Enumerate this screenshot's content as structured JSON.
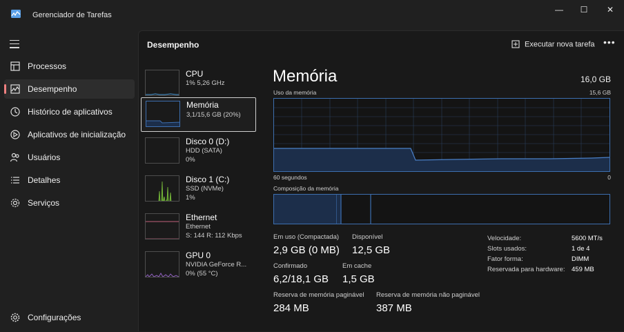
{
  "app": {
    "title": "Gerenciador de Tarefas"
  },
  "window_controls": {
    "minimize": "—",
    "maximize": "☐",
    "close": "✕"
  },
  "sidebar": {
    "items": [
      {
        "label": "Processos",
        "icon": "processes-icon"
      },
      {
        "label": "Desempenho",
        "icon": "performance-icon",
        "active": true
      },
      {
        "label": "Histórico de aplicativos",
        "icon": "history-icon"
      },
      {
        "label": "Aplicativos de inicialização",
        "icon": "startup-icon"
      },
      {
        "label": "Usuários",
        "icon": "users-icon"
      },
      {
        "label": "Detalhes",
        "icon": "details-icon"
      },
      {
        "label": "Serviços",
        "icon": "services-icon"
      }
    ],
    "settings_label": "Configurações"
  },
  "header": {
    "title": "Desempenho",
    "new_task_label": "Executar nova tarefa",
    "more": "•••"
  },
  "devices": [
    {
      "name": "CPU",
      "line1": "1% 5,26 GHz",
      "line2": ""
    },
    {
      "name": "Memória",
      "line1": "3,1/15,6 GB (20%)",
      "line2": "",
      "selected": true
    },
    {
      "name": "Disco 0 (D:)",
      "line1": "HDD (SATA)",
      "line2": "0%"
    },
    {
      "name": "Disco 1 (C:)",
      "line1": "SSD (NVMe)",
      "line2": "1%"
    },
    {
      "name": "Ethernet",
      "line1": "Ethernet",
      "line2": "S: 144 R: 112 Kbps"
    },
    {
      "name": "GPU 0",
      "line1": "NVIDIA GeForce R...",
      "line2": "0% (55 °C)"
    }
  ],
  "memory": {
    "title": "Memória",
    "total": "16,0 GB",
    "usage_label": "Uso da memória",
    "usage_max": "15,6 GB",
    "time_left": "60 segundos",
    "time_right": "0",
    "composition_label": "Composição da memória",
    "stats": {
      "in_use_label": "Em uso (Compactada)",
      "in_use_value": "2,9 GB (0 MB)",
      "available_label": "Disponível",
      "available_value": "12,5 GB",
      "committed_label": "Confirmado",
      "committed_value": "6,2/18,1 GB",
      "cached_label": "Em cache",
      "cached_value": "1,5 GB",
      "paged_label": "Reserva de memória paginável",
      "paged_value": "284 MB",
      "nonpaged_label": "Reserva de memória não paginável",
      "nonpaged_value": "387 MB"
    },
    "specs": [
      {
        "label": "Velocidade:",
        "value": "5600 MT/s"
      },
      {
        "label": "Slots usados:",
        "value": "1 de 4"
      },
      {
        "label": "Fator forma:",
        "value": "DIMM"
      },
      {
        "label": "Reservada para hardware:",
        "value": "459 MB"
      }
    ]
  },
  "colors": {
    "memory": "#3d6fb0",
    "memory_fill": "#1c2e4a",
    "cpu": "#4a9ad8",
    "disk1": "#7cc23c",
    "ethernet": "#c0607a",
    "gpu": "#9060c0",
    "accent_indicator": "#f08080"
  }
}
